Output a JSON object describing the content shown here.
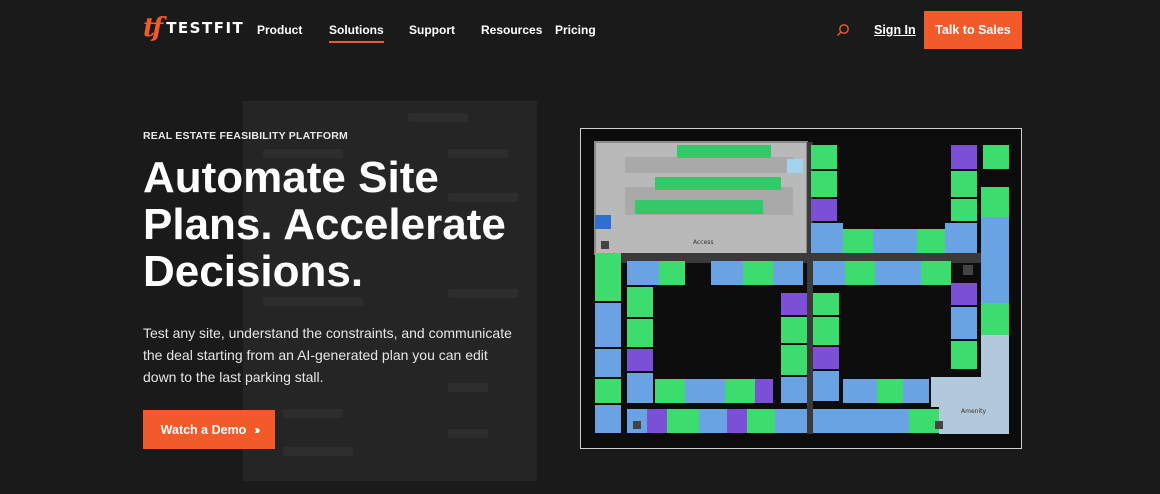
{
  "header": {
    "logo_mark": "tf",
    "logo_text": "TESTFIT",
    "nav": [
      {
        "label": "Product"
      },
      {
        "label": "Solutions"
      },
      {
        "label": "Support"
      },
      {
        "label": "Resources"
      },
      {
        "label": "Pricing"
      }
    ],
    "search_icon": "search-icon",
    "signin_label": "Sign In",
    "cta_label": "Talk to Sales"
  },
  "hero": {
    "eyebrow": "REAL ESTATE FEASIBILITY PLATFORM",
    "headline": "Automate Site Plans. Accelerate Decisions.",
    "body": "Test any site, understand the constraints, and communicate the deal starting from an AI-generated plan you can edit down to the last parking stall.",
    "cta_label": "Watch a Demo",
    "cta_icon": "triple-chevron-right-icon"
  },
  "plan": {
    "access_label": "Access",
    "amenity_label": "Amenity"
  },
  "colors": {
    "accent": "#f25a2a",
    "background": "#1b1a1b",
    "unit_green": "#3ddc6e",
    "unit_blue": "#6aa3e3",
    "unit_purple": "#7b4fd6",
    "parking_grey": "#b5b5b5"
  }
}
